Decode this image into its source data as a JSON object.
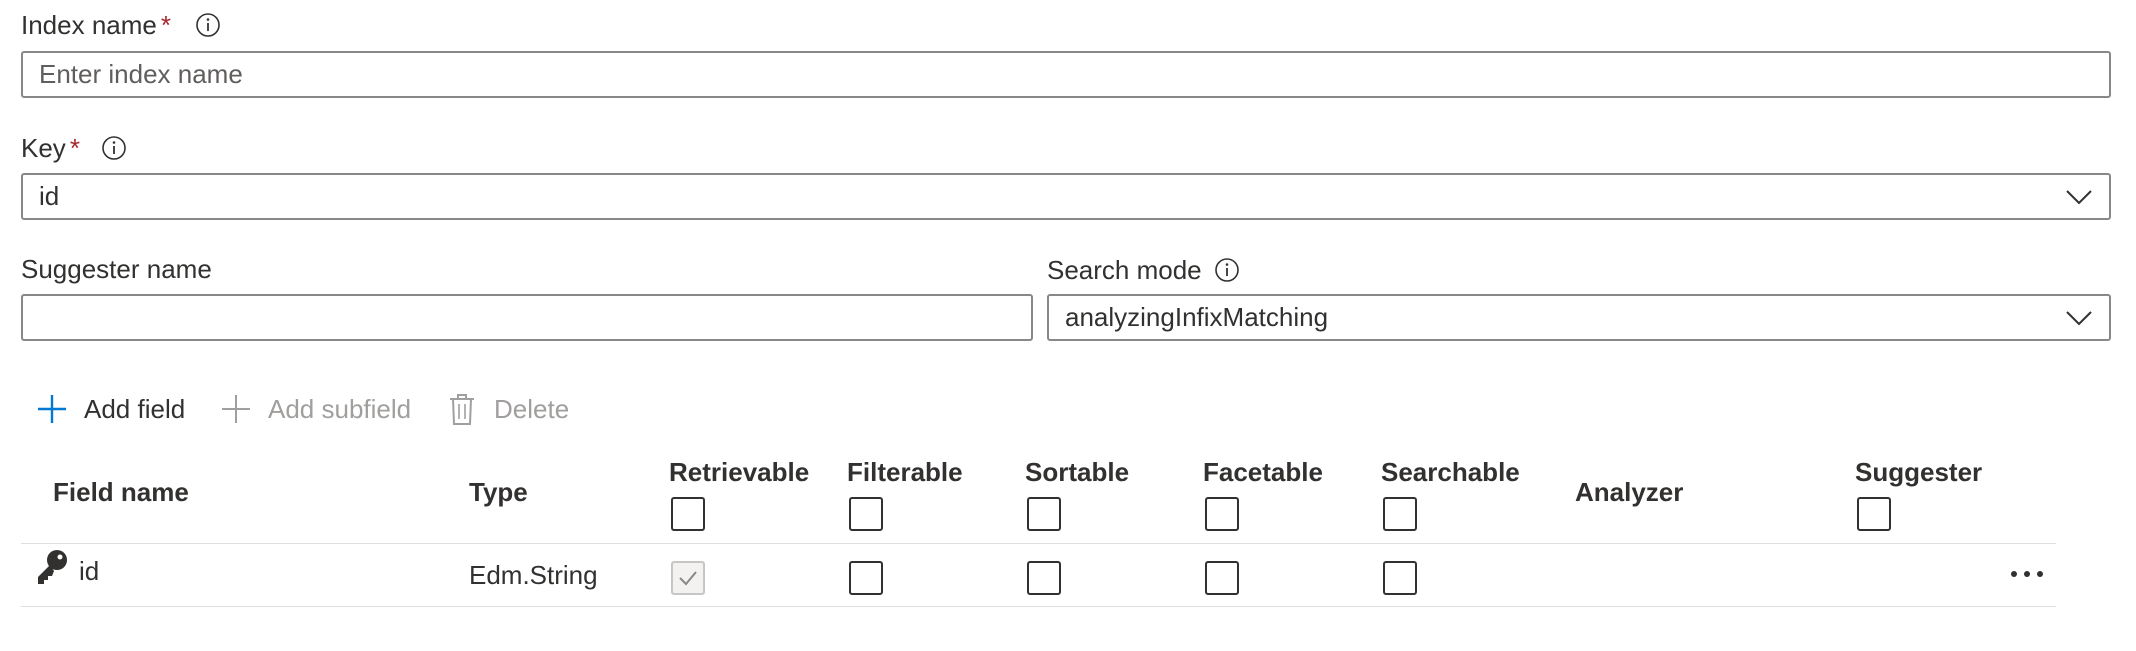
{
  "index_name": {
    "label": "Index name",
    "required_marker": "*",
    "info_icon": "info-icon",
    "placeholder": "Enter index name",
    "value": ""
  },
  "key": {
    "label": "Key",
    "required_marker": "*",
    "info_icon": "info-icon",
    "value": "id",
    "chevron_icon": "chevron-down-icon"
  },
  "suggester_name": {
    "label": "Suggester name",
    "value": ""
  },
  "search_mode": {
    "label": "Search mode",
    "info_icon": "info-icon",
    "value": "analyzingInfixMatching",
    "chevron_icon": "chevron-down-icon"
  },
  "toolbar": {
    "add_field": "Add field",
    "add_subfield": "Add subfield",
    "delete": "Delete",
    "add_field_enabled": true,
    "add_subfield_enabled": false,
    "delete_enabled": false
  },
  "table": {
    "headers": {
      "field_name": "Field name",
      "type": "Type",
      "retrievable": "Retrievable",
      "filterable": "Filterable",
      "sortable": "Sortable",
      "facetable": "Facetable",
      "searchable": "Searchable",
      "analyzer": "Analyzer",
      "suggester": "Suggester"
    },
    "rows": [
      {
        "field_name": "id",
        "key_icon": "key-icon",
        "type": "Edm.String",
        "retrievable": "checked-disabled",
        "filterable": "unchecked",
        "sortable": "unchecked",
        "facetable": "unchecked",
        "searchable": "unchecked",
        "analyzer": "",
        "more_icon": "more-options-icon"
      }
    ]
  },
  "colors": {
    "accent": "#0078d4",
    "required": "#a4262c",
    "border": "#8a8886",
    "disabled_text": "#a19f9d",
    "divider": "#e1dfdd"
  }
}
